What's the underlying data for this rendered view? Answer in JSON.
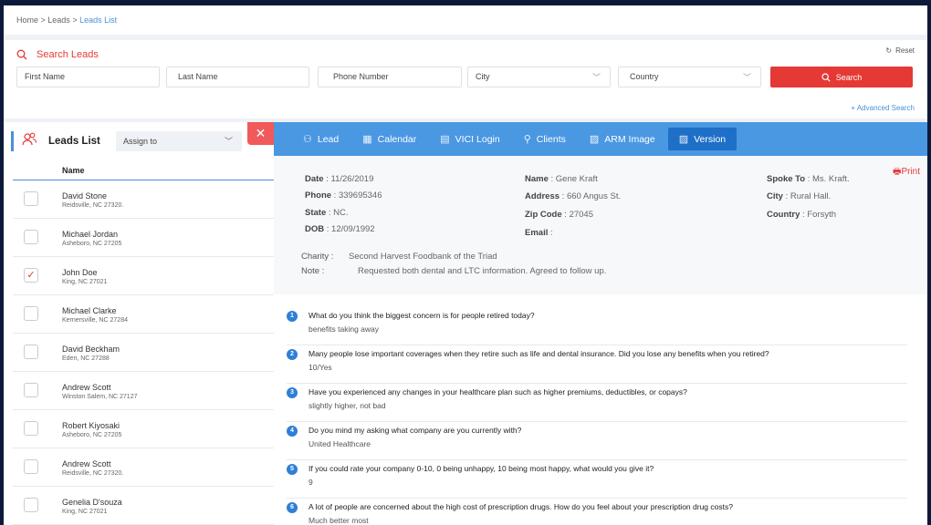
{
  "breadcrumb": {
    "home": "Home",
    "sep1": " > ",
    "leads": "Leads",
    "sep2": " > ",
    "current": "Leads List"
  },
  "search": {
    "title": "Search Leads",
    "reset_label": "Reset",
    "first_name_placeholder": "First Name",
    "last_name_placeholder": "Last Name",
    "phone_placeholder": "Phone Number",
    "city_selected": "City",
    "country_selected": "Country",
    "search_button": "Search",
    "advanced_label": "+ Advanced Search"
  },
  "leads_list": {
    "title": "Leads List",
    "assign_selected": "Assign to",
    "close_glyph": "✕",
    "column_name": "Name",
    "rows": [
      {
        "name": "David Stone",
        "address": "Reidsville, NC 27320.",
        "checked": false
      },
      {
        "name": "Michael Jordan",
        "address": "Asheboro, NC 27205",
        "checked": false
      },
      {
        "name": "John Doe",
        "address": "King, NC 27021",
        "checked": true
      },
      {
        "name": "Michael Clarke",
        "address": "Kernersville, NC 27284",
        "checked": false
      },
      {
        "name": "David Beckham",
        "address": "Eden, NC 27288",
        "checked": false
      },
      {
        "name": "Andrew Scott",
        "address": "Winston Salem, NC 27127",
        "checked": false
      },
      {
        "name": "Robert Kiyosaki",
        "address": "Asheboro, NC 27205",
        "checked": false
      },
      {
        "name": "Andrew Scott",
        "address": "Reidsville, NC 27320.",
        "checked": false
      },
      {
        "name": "Genelia D'souza",
        "address": "King, NC 27021",
        "checked": false
      }
    ]
  },
  "tabs": [
    {
      "label": "Lead",
      "icon": "lead-icon",
      "active": false
    },
    {
      "label": "Calendar",
      "icon": "calendar-icon",
      "active": false
    },
    {
      "label": "VICI Login",
      "icon": "vici-login-icon",
      "active": false
    },
    {
      "label": "Clients",
      "icon": "clients-icon",
      "active": false
    },
    {
      "label": "ARM Image",
      "icon": "image-icon",
      "active": false
    },
    {
      "label": "Version",
      "icon": "version-icon",
      "active": true
    }
  ],
  "lead_detail": {
    "print_label": "Print",
    "date_label": "Date",
    "date": "11/26/2019",
    "phone_label": "Phone",
    "phone": "339695346",
    "state_label": "State",
    "state": "NC.",
    "dob_label": "DOB",
    "dob": "12/09/1992",
    "name_label": "Name",
    "name": "Gene Kraft",
    "address_label": "Address",
    "address": "660 Angus St.",
    "zip_label": "Zip Code",
    "zip": "27045",
    "email_label": "Email",
    "email": "",
    "spoke_label": "Spoke To",
    "spoke": "Ms. Kraft.",
    "city_label": "City",
    "city": "Rural Hall.",
    "country_label": "Country",
    "country": "Forsyth",
    "charity_label": "Charity :",
    "charity": "Second Harvest Foodbank of the Triad",
    "note_label": "Note :",
    "note": "Requested both dental and LTC information. Agreed to follow up."
  },
  "questions": [
    {
      "num": "1",
      "q": "What do you think the biggest concern is for people retired today?",
      "a": "benefits taking away"
    },
    {
      "num": "2",
      "q": "Many people lose important coverages when they retire such as life and dental insurance. Did you lose any benefits when you retired?",
      "a": "10/Yes"
    },
    {
      "num": "3",
      "q": "Have you experienced any changes in your healthcare plan such as higher premiums, deductibles, or copays?",
      "a": "slightly higher, not bad"
    },
    {
      "num": "4",
      "q": "Do you mind my asking what company are you currently with?",
      "a": "United Healthcare"
    },
    {
      "num": "5",
      "q": "If you could rate your company 0-10, 0 being unhappy, 10 being most happy, what would you give it?",
      "a": "9"
    },
    {
      "num": "6",
      "q": "A lot of people are concerned about the high cost of prescription drugs. How do you feel about your prescription drug costs?",
      "a": "Much better most"
    }
  ],
  "colors": {
    "accent": "#e53935",
    "primary": "#4a97e2",
    "active_tab": "#1e6fc8"
  }
}
